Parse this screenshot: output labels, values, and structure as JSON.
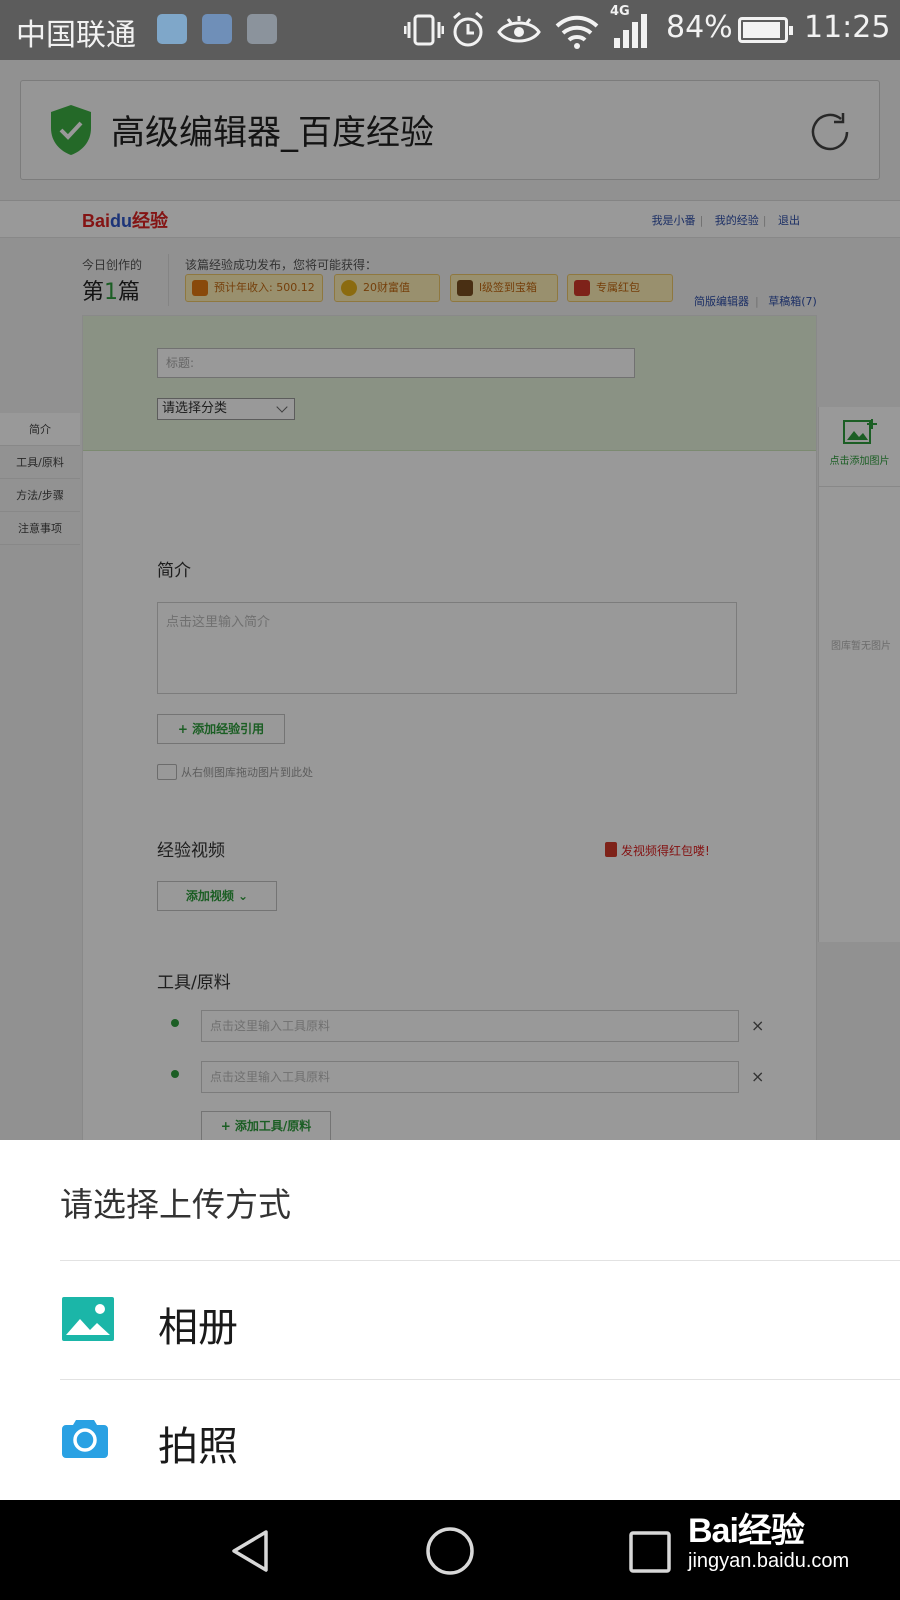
{
  "status_bar": {
    "carrier": "中国联通",
    "network": "4G",
    "battery": "84%",
    "battery_level": 0.84,
    "time": "11:25"
  },
  "browser": {
    "page_title": "高级编辑器_百度经验"
  },
  "site": {
    "logo_bai": "Bai",
    "logo_du": "du",
    "logo_suffix": "经验",
    "user_links": [
      "我是小番",
      "我的经验",
      "退出"
    ]
  },
  "stats": {
    "today_label": "今日创作的",
    "today_prefix": "第",
    "today_count": "1",
    "today_suffix": "篇",
    "reward_label": "该篇经验成功发布，您将可能获得：",
    "rewards": [
      "预计年收入: 500.12",
      "20财富值",
      "l级签到宝箱",
      "专属红包"
    ],
    "editor_links": [
      "简版编辑器",
      "草稿箱(7)"
    ]
  },
  "left_nav": [
    "简介",
    "工具/原料",
    "方法/步骤",
    "注意事项"
  ],
  "editor": {
    "title_placeholder": "标题:",
    "category": "请选择分类",
    "intro_heading": "简介",
    "intro_placeholder": "点击这里输入简介",
    "add_reference": "+ 添加经验引用",
    "drag_hint": "从右侧图库拖动图片到此处",
    "video_heading": "经验视频",
    "video_promo": "发视频得红包喽!",
    "add_video": "添加视频 ⌄",
    "tools_heading": "工具/原料",
    "tool_placeholder_1": "点击这里输入工具原料",
    "tool_placeholder_2": "点击这里输入工具原料",
    "delete_mark": "×",
    "add_tool": "+ 添加工具/原料"
  },
  "right_panel": {
    "add_image": "点击添加图片",
    "empty_library": "图库暂无图片"
  },
  "sheet": {
    "title": "请选择上传方式",
    "options": [
      {
        "label": "相册",
        "icon": "gallery-icon",
        "color": "#1bb6a8"
      },
      {
        "label": "拍照",
        "icon": "camera-icon",
        "color": "#2aa1e3"
      }
    ]
  },
  "watermark": {
    "top": "Bai经验",
    "bottom": "jingyan.baidu.com"
  }
}
